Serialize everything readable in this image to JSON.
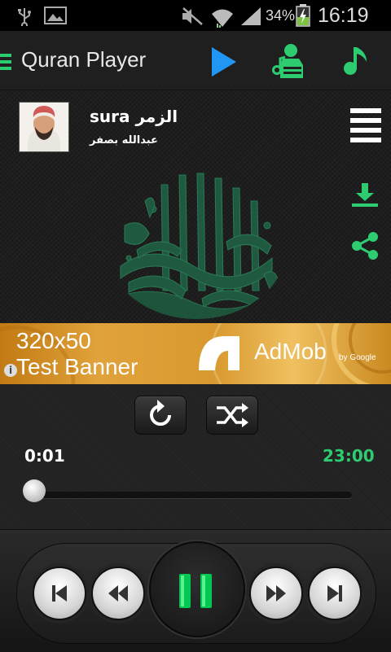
{
  "status_bar": {
    "battery_percent": "34%",
    "time": "16:19"
  },
  "action_bar": {
    "title": "Quran Player"
  },
  "now_playing": {
    "sura_prefix": "sura",
    "sura_name": "الزمر",
    "reciter": "عبدالله بصفر"
  },
  "ad_banner": {
    "line1": "320x50",
    "line2": "Test Banner",
    "brand": "AdMob",
    "by": "by Google",
    "info_glyph": "i"
  },
  "playback": {
    "elapsed": "0:01",
    "duration": "23:00",
    "progress_fraction": 0.001
  },
  "colors": {
    "accent_green": "#2ecc71",
    "play_blue": "#2196f3",
    "pause_green": "#00c853"
  },
  "icons": {
    "menu": "menu-icon",
    "play": "play-icon",
    "reciters": "reciter-icon",
    "music": "music-note-icon",
    "list": "playlist-icon",
    "download": "download-icon",
    "share": "share-icon",
    "repeat": "repeat-icon",
    "shuffle": "shuffle-icon",
    "skip_previous": "skip-previous-icon",
    "rewind": "rewind-icon",
    "pause": "pause-icon",
    "fast_forward": "fast-forward-icon",
    "skip_next": "skip-next-icon"
  }
}
